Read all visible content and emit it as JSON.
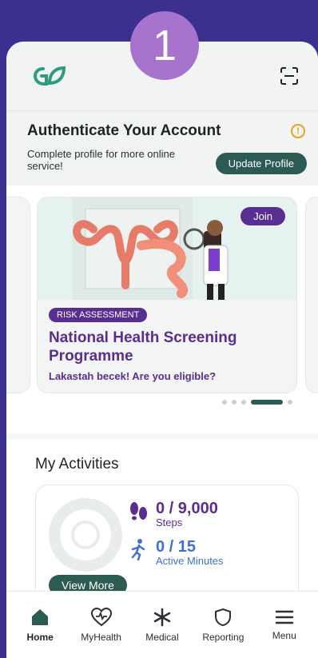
{
  "step_number": "1",
  "auth": {
    "title": "Authenticate Your Account",
    "description": "Complete profile for more online service!",
    "update_button": "Update Profile"
  },
  "promo": {
    "join_label": "Join",
    "badge": "RISK ASSESSMENT",
    "title": "National Health Screening Programme",
    "subtitle": "Lakastah becek! Are you eligible?"
  },
  "activities": {
    "title": "My Activities",
    "steps_value": "0 / 9,000",
    "steps_label": "Steps",
    "minutes_value": "0 / 15",
    "minutes_label": "Active Minutes",
    "view_more": "View More"
  },
  "nav": [
    {
      "label": "Home",
      "icon": "home-icon"
    },
    {
      "label": "MyHealth",
      "icon": "heart-pulse-icon"
    },
    {
      "label": "Medical",
      "icon": "medical-star-icon"
    },
    {
      "label": "Reporting",
      "icon": "shield-icon"
    },
    {
      "label": "Menu",
      "icon": "menu-icon"
    }
  ],
  "colors": {
    "primary": "#2c5b53",
    "accent_purple": "#5a2d91",
    "step_badge": "#a873cd",
    "background": "#3b2f8f"
  }
}
